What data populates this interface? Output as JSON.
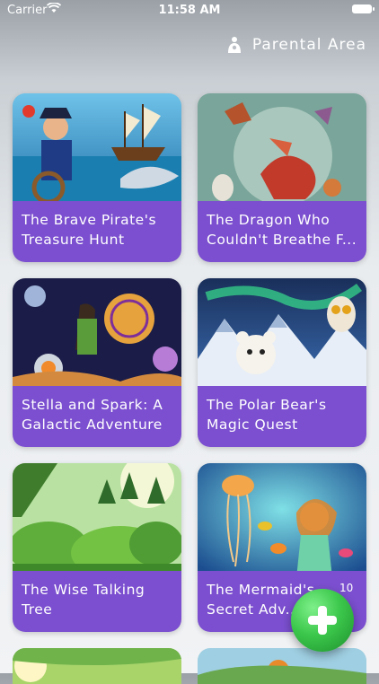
{
  "status_bar": {
    "carrier": "Carrier",
    "time": "11:58 AM",
    "wifi_icon": "wifi-icon",
    "battery_icon": "battery-icon"
  },
  "header": {
    "parental_label": "Parental Area",
    "parental_icon": "parent-child-icon"
  },
  "stories": [
    {
      "title": "The Brave Pirate's Treasure Hunt"
    },
    {
      "title": "The Dragon Who Couldn't Breathe F..."
    },
    {
      "title": "Stella and Spark: A Galactic Adventure"
    },
    {
      "title": "The Polar Bear's Magic Quest"
    },
    {
      "title": "The Wise Talking Tree"
    },
    {
      "title": "The Mermaid's Secret Adv..."
    }
  ],
  "fab": {
    "badge": "10",
    "icon": "plus-icon"
  },
  "colors": {
    "card_title_bg": "#7b4fcf",
    "fab_green": "#3cc84c"
  }
}
